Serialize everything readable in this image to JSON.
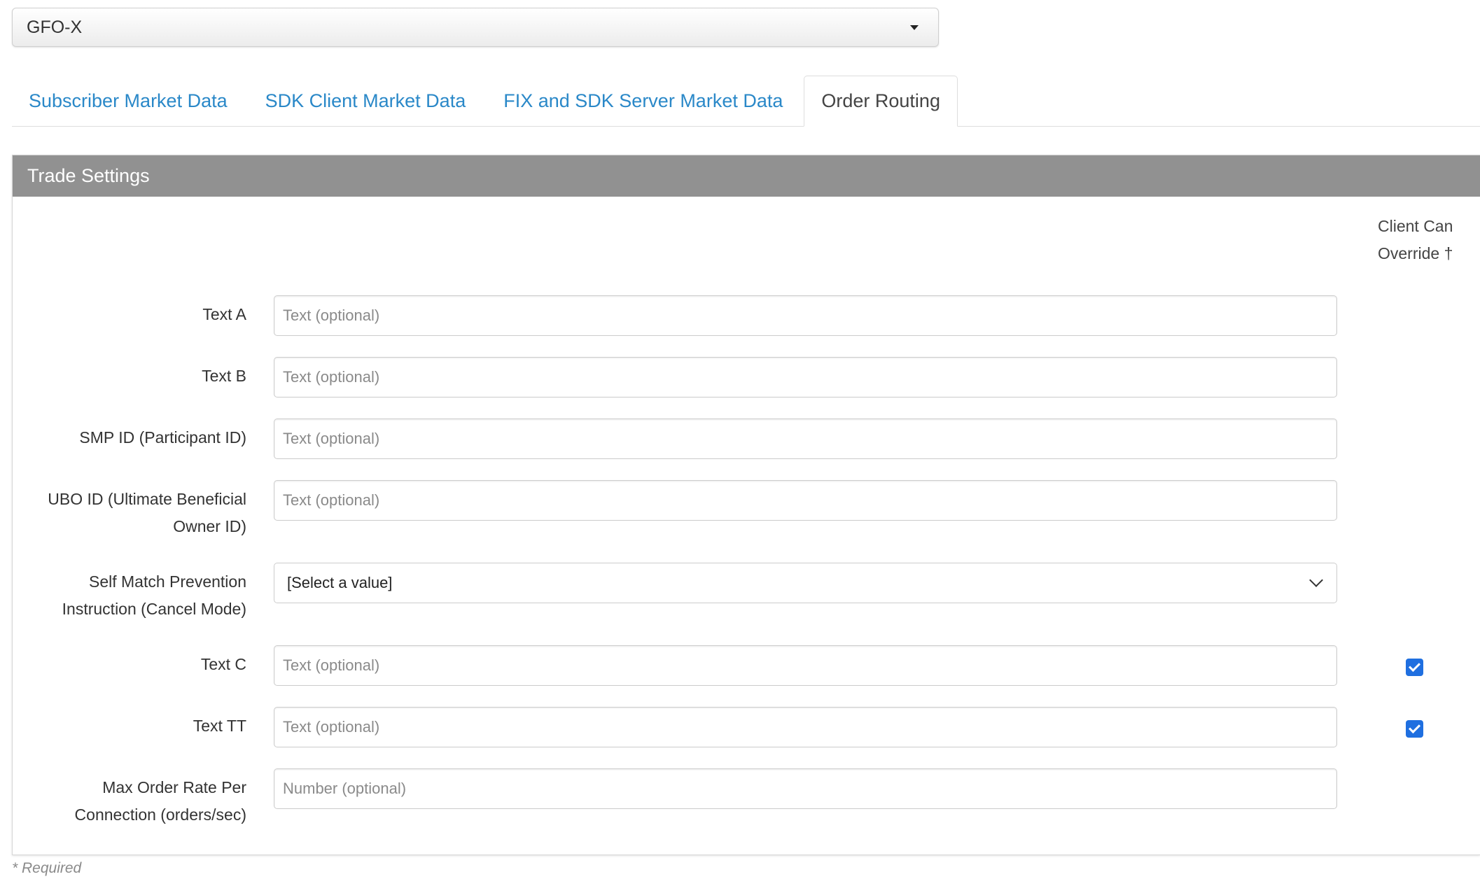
{
  "exchange_selector": {
    "value": "GFO-X"
  },
  "tabs": [
    {
      "label": "Subscriber Market Data",
      "active": false
    },
    {
      "label": "SDK Client Market Data",
      "active": false
    },
    {
      "label": "FIX and SDK Server Market Data",
      "active": false
    },
    {
      "label": "Order Routing",
      "active": true
    }
  ],
  "panel": {
    "title": "Trade Settings",
    "override_header_line1": "Client Can",
    "override_header_line2": "Override †",
    "fields": [
      {
        "label": "Text A",
        "type": "text",
        "placeholder": "Text (optional)",
        "value": "",
        "override": false
      },
      {
        "label": "Text B",
        "type": "text",
        "placeholder": "Text (optional)",
        "value": "",
        "override": false
      },
      {
        "label": "SMP ID (Participant ID)",
        "type": "text",
        "placeholder": "Text (optional)",
        "value": "",
        "override": false
      },
      {
        "label_line1": "UBO ID (Ultimate Beneficial",
        "label_line2": "Owner ID)",
        "type": "text",
        "placeholder": "Text (optional)",
        "value": "",
        "override": false
      },
      {
        "label_line1": "Self Match Prevention",
        "label_line2": "Instruction (Cancel Mode)",
        "type": "select",
        "value": "[Select a value]",
        "override": false
      },
      {
        "label": "Text C",
        "type": "text",
        "placeholder": "Text (optional)",
        "value": "",
        "override": true
      },
      {
        "label": "Text TT",
        "type": "text",
        "placeholder": "Text (optional)",
        "value": "",
        "override": true
      },
      {
        "label_line1": "Max Order Rate Per",
        "label_line2": "Connection (orders/sec)",
        "type": "text",
        "placeholder": "Number (optional)",
        "value": "",
        "override": false
      }
    ]
  },
  "footer": {
    "required_note": "* Required"
  },
  "colors": {
    "link_blue": "#2a88c8",
    "header_gray": "#919191",
    "checkbox_blue": "#1f6fe0"
  }
}
